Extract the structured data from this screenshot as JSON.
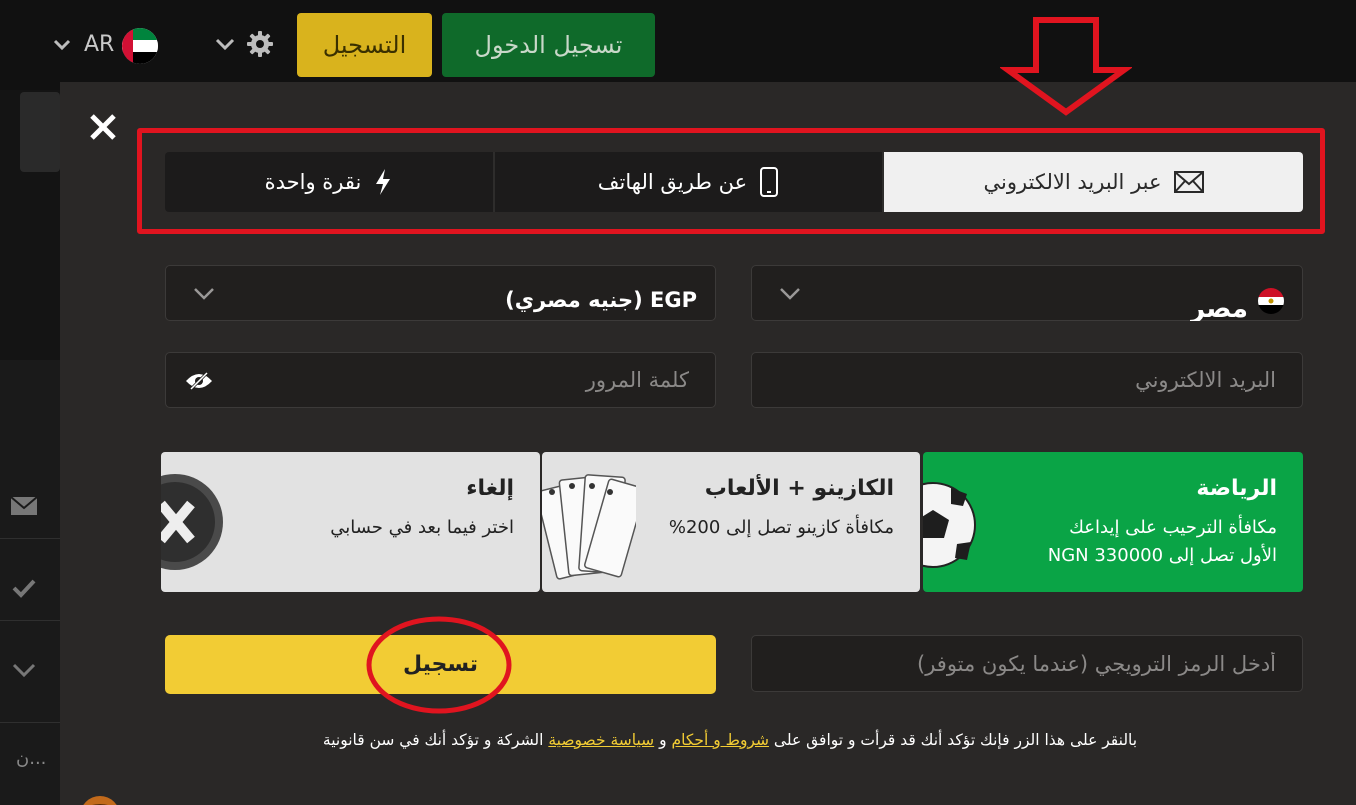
{
  "header": {
    "login_label": "تسجيل الدخول",
    "register_label": "التسجيل",
    "language": "AR",
    "settings_icon": "gear-icon",
    "flag_icon": "uae-flag-icon"
  },
  "sidebar": {
    "truncated_text": "ن..."
  },
  "modal": {
    "tabs": [
      {
        "label": "عبر البريد الالكتروني",
        "icon": "envelope-icon",
        "active": true
      },
      {
        "label": "عن طريق الهاتف",
        "icon": "phone-icon",
        "active": false
      },
      {
        "label": "نقرة واحدة",
        "icon": "lightning-icon",
        "active": false
      }
    ],
    "country_value": "مصر",
    "currency_value": "EGP (جنيه مصري)",
    "email_placeholder": "البريد الالكتروني",
    "password_placeholder": "كلمة المرور",
    "bonuses": [
      {
        "title": "الرياضة",
        "desc": "مكافأة الترحيب على إيداعك\nالأول تصل إلى NGN 330000"
      },
      {
        "title": "الكازينو + الألعاب",
        "desc": "مكافأة كازينو تصل إلى 200%"
      },
      {
        "title": "إلغاء",
        "desc": "اختر فيما بعد في حسابي"
      }
    ],
    "promo_placeholder": "أدخل الرمز الترويجي (عندما يكون متوفر)",
    "register_button": "تسجيل",
    "terms": {
      "before": "بالنقر على هذا الزر فإنك تؤكد أنك قد قرأت و توافق على ",
      "terms_link": "شروط و أحكام",
      "middle": " و ",
      "privacy_link": "سياسة خصوصية",
      "after": " الشركة و تؤكد أنك في سن قانونية"
    }
  },
  "colors": {
    "accent_yellow": "#f2cc34",
    "sports_green": "#0aa446",
    "login_green": "#0f6a2a",
    "annotation_red": "#e0141f",
    "modal_bg": "#2a2827"
  }
}
